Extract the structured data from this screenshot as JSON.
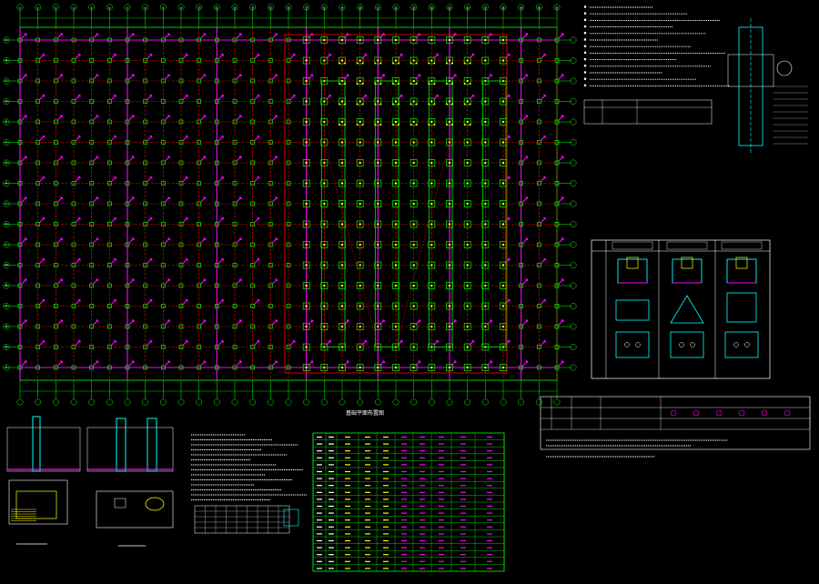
{
  "drawing": {
    "background": "#000000",
    "colors": {
      "axis": "#00ff00",
      "beam": "#ff0000",
      "grade_beam": "#ff00ff",
      "pile": "#00ff00",
      "text": "#ffffff",
      "highlight": "#ffff00",
      "detail": "#00ffff"
    },
    "titles": {
      "main_plan": "基础平面布置图",
      "table": "",
      "notes": "",
      "detail_left": "",
      "detail_mid": ""
    },
    "axis_labels_top": [
      "①",
      "②",
      "③",
      "④",
      "⑤",
      "⑥",
      "⑦",
      "⑧",
      "⑨",
      "⑩",
      "⑪",
      "⑫",
      "⑬",
      "⑭",
      "⑮",
      "⑯",
      "⑰",
      "⑱",
      "⑲",
      "⑳",
      "㉑",
      "㉒",
      "㉓",
      "㉔",
      "㉕",
      "㉖",
      "㉗",
      "㉘",
      "㉙",
      "㉚",
      "㉛"
    ],
    "axis_labels_left": [
      "A",
      "B",
      "C",
      "D",
      "E",
      "F",
      "G",
      "H",
      "J",
      "K",
      "L",
      "M",
      "N",
      "P",
      "Q",
      "R",
      "S"
    ]
  }
}
